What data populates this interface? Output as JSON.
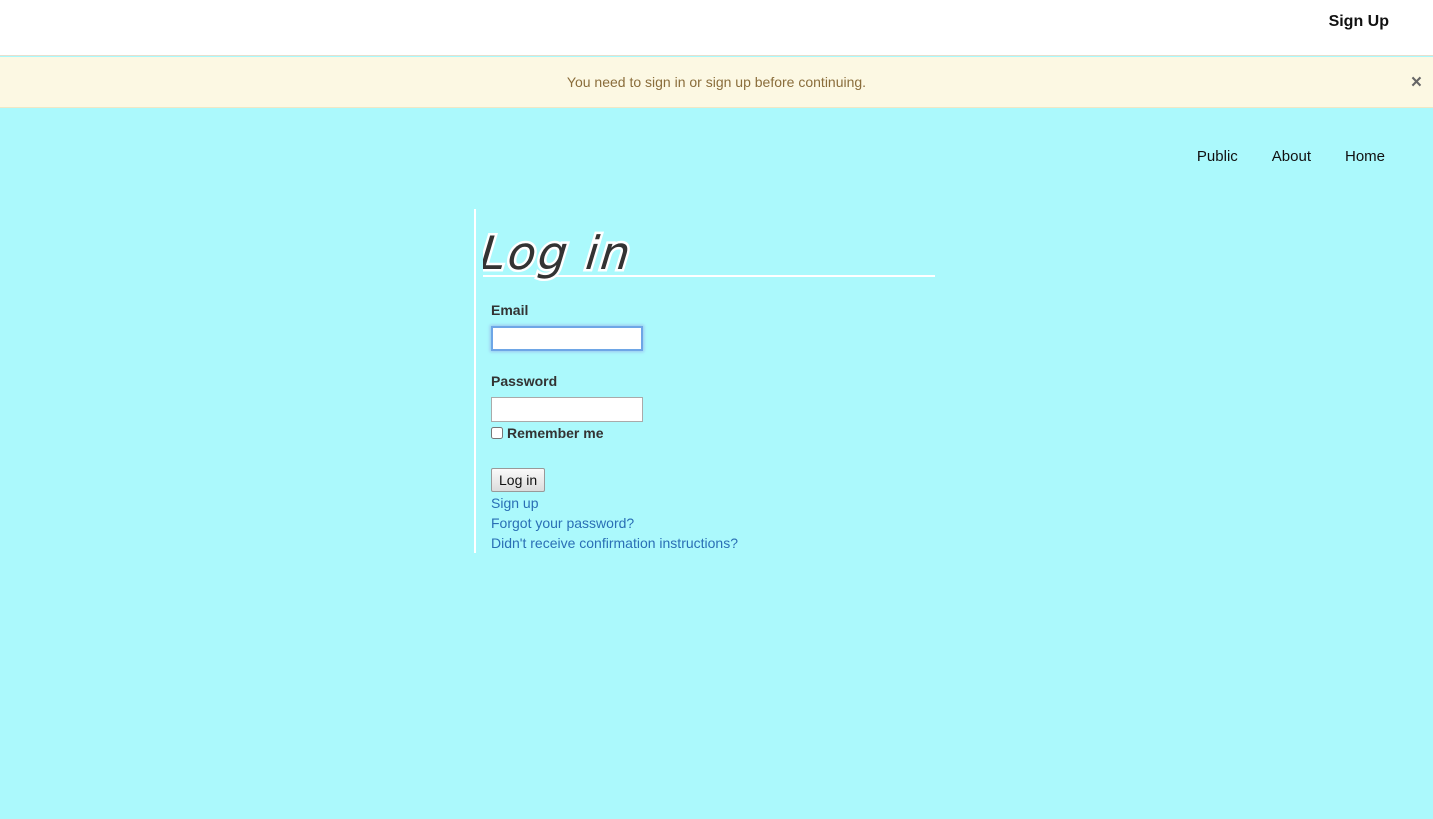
{
  "header": {
    "signup_label": "Sign Up"
  },
  "alert": {
    "message": "You need to sign in or sign up before continuing.",
    "close_glyph": "×"
  },
  "nav": {
    "items": [
      {
        "label": "Public"
      },
      {
        "label": "About"
      },
      {
        "label": "Home"
      }
    ]
  },
  "form": {
    "title": "Log in",
    "email_label": "Email",
    "email_value": "",
    "password_label": "Password",
    "password_value": "",
    "remember_label": "Remember me",
    "remember_checked": false,
    "submit_label": "Log in"
  },
  "links": {
    "signup": "Sign up",
    "forgot": "Forgot your password?",
    "confirm": "Didn't receive confirmation instructions?"
  },
  "colors": {
    "page_background": "#abf9fc",
    "alert_background": "#fcf8e3",
    "alert_text": "#8a6d3b",
    "link": "#2a6fb5",
    "focus_ring": "#6ea6e6"
  }
}
